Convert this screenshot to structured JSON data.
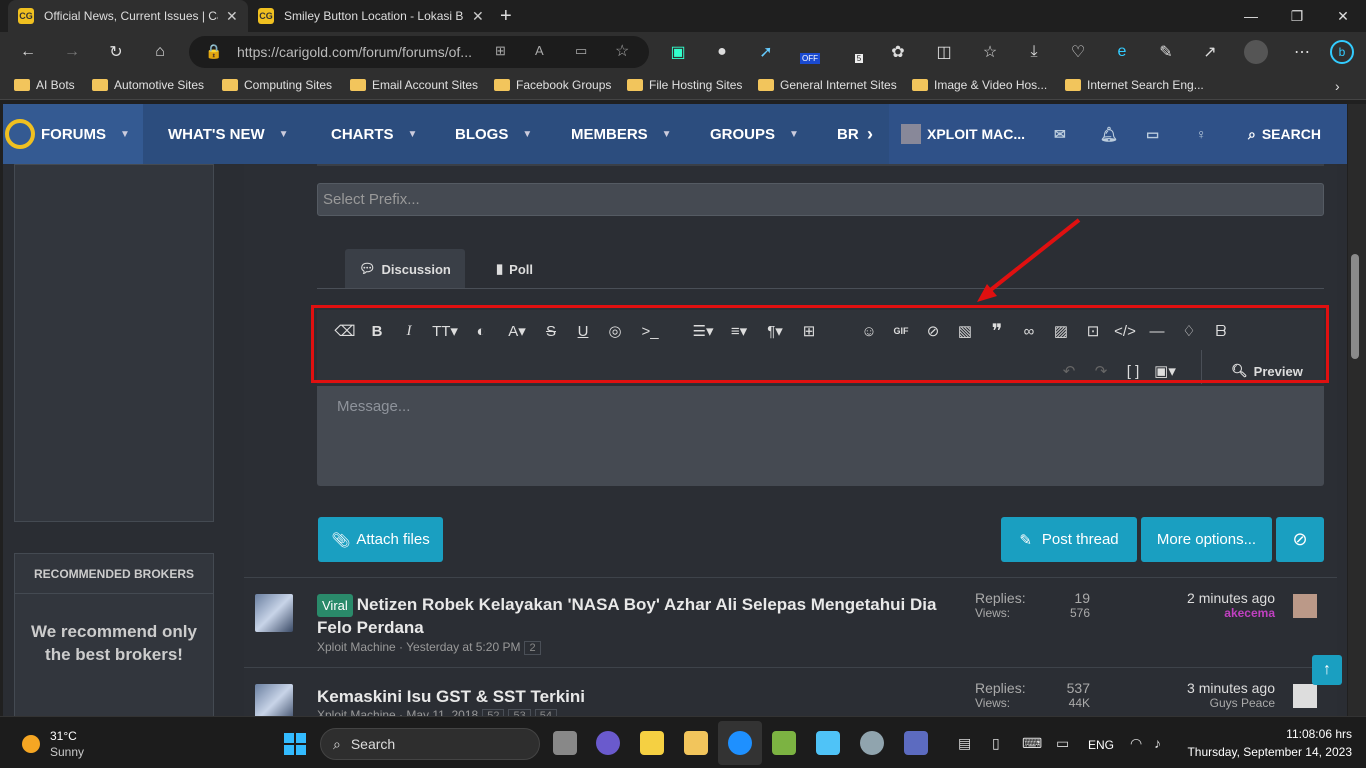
{
  "browser": {
    "tabs": [
      {
        "title": "Official News, Current Issues | Ca",
        "favicon": "CG"
      },
      {
        "title": "Smiley Button Location - Lokasi B",
        "favicon": "CG"
      }
    ],
    "url": "https://carigold.com/forum/forums/of...",
    "bookmarks": [
      "AI Bots",
      "Automotive Sites",
      "Computing Sites",
      "Email Account Sites",
      "Facebook Groups",
      "File Hosting Sites",
      "General Internet Sites",
      "Image & Video Hos...",
      "Internet Search Eng..."
    ],
    "extension_badge": "OFF",
    "extension_count": "5"
  },
  "nav": {
    "logo": "FORUMS",
    "items": [
      "WHAT'S NEW",
      "CHARTS",
      "BLOGS",
      "MEMBERS",
      "GROUPS",
      "BR"
    ],
    "user": "XPLOIT MAC...",
    "search": "SEARCH"
  },
  "sidebar": {
    "brokers_title": "RECOMMENDED BROKERS",
    "brokers_text": "We recommend only the best brokers!"
  },
  "editor": {
    "prefix_placeholder": "Select Prefix...",
    "tabs": [
      "Discussion",
      "Poll"
    ],
    "gif_label": "GIF",
    "preview": "Preview",
    "message_placeholder": "Message...",
    "attach": "Attach files",
    "post": "Post thread",
    "more": "More options..."
  },
  "threads": [
    {
      "badge": "Viral",
      "title": "Netizen Robek Kelayakan 'NASA Boy' Azhar Ali Selepas Mengetahui Dia Felo Perdana",
      "meta": "Xploit Machine · Yesterday at 5:20 PM",
      "pages": [
        "2"
      ],
      "replies_label": "Replies:",
      "replies": "19",
      "views_label": "Views:",
      "views": "576",
      "last_time": "2 minutes ago",
      "last_user": "akecema",
      "last_user_color": "#c040c0"
    },
    {
      "badge": "",
      "title": "Kemaskini Isu GST & SST Terkini",
      "meta": "Xploit Machine · May 11, 2018",
      "pages": [
        "52",
        "53",
        "54"
      ],
      "replies_label": "Replies:",
      "replies": "537",
      "views_label": "Views:",
      "views": "44K",
      "last_time": "3 minutes ago",
      "last_user": "Guys Peace",
      "last_user_color": "#aaaaaa"
    }
  ],
  "taskbar": {
    "temp": "31°C",
    "weather": "Sunny",
    "search": "Search",
    "lang": "ENG",
    "time": "11:08:06 hrs",
    "date": "Thursday, September 14, 2023"
  },
  "colors": {
    "accent": "#1a9fc1",
    "nav": "#2c4d7e",
    "highlight": "#e01010"
  }
}
